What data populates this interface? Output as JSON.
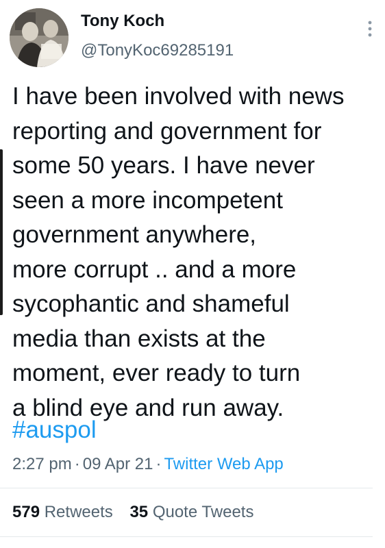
{
  "user": {
    "display_name": "Tony Koch",
    "handle": "@TonyKoc69285191"
  },
  "tweet": {
    "text": "I have been involved with news\nreporting and government for\nsome 50 years. I have never\nseen a more incompetent\ngovernment anywhere,\nmore corrupt .. and a more\nsycophantic and shameful\nmedia than exists at the\nmoment, ever ready to turn\na blind eye and run away.",
    "hashtag": "#auspol",
    "time": "2:27 pm",
    "date": "09 Apr 21",
    "separator": "·",
    "source": "Twitter Web App"
  },
  "stats": {
    "retweets_count": "579",
    "retweets_label": "Retweets",
    "quote_count": "35",
    "quote_label": "Quote Tweets"
  },
  "icons": {
    "more": "more-vertical-icon"
  },
  "colors": {
    "link": "#1d9bf0",
    "secondary_text": "#536471",
    "primary_text": "#0f1419"
  }
}
